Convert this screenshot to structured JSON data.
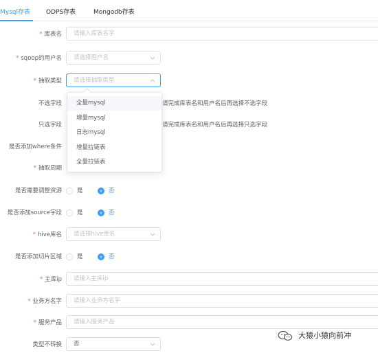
{
  "tabs": [
    {
      "label": "Mysql存表",
      "active": true
    },
    {
      "label": "ODPS存表",
      "active": false
    },
    {
      "label": "Mongodb存表",
      "active": false
    }
  ],
  "form": {
    "table_name": {
      "label": "库表名",
      "required": true,
      "placeholder": "请输入库表名字"
    },
    "sqoop_user": {
      "label": "sqoop的用户名",
      "required": true,
      "placeholder": "请选择用户名"
    },
    "extract_type": {
      "label": "抽取类型",
      "required": true,
      "placeholder": "请选择抽取类型"
    },
    "exclude_fields": {
      "label": "不选字段",
      "hint": "请完成库表名和用户名后再选择不选字段"
    },
    "only_fields": {
      "label": "只选字段",
      "hint": "请完成库表名和用户名后再选择只选字段"
    },
    "add_where": {
      "label": "是否添加where条件"
    },
    "extract_period": {
      "label": "抽取周期",
      "required": true
    },
    "adjust_resource": {
      "label": "是否需要调整资源",
      "options": [
        "是",
        "否"
      ],
      "selected": "否"
    },
    "add_source_field": {
      "label": "是否添加source字段",
      "options": [
        "是",
        "否"
      ],
      "selected": "否"
    },
    "hive_db": {
      "label": "hive库名",
      "required": true,
      "placeholder": "请选择hive库名"
    },
    "add_partition": {
      "label": "是否添加切片区域",
      "options": [
        "是",
        "否"
      ],
      "selected": "否"
    },
    "master_ip": {
      "label": "主库ip",
      "required": true,
      "placeholder": "请输入主库ip"
    },
    "business_name": {
      "label": "业务方名字",
      "required": true,
      "placeholder": "请输入业务方名字"
    },
    "service_product": {
      "label": "服务产品",
      "required": true,
      "placeholder": "请输入服务产品"
    },
    "type_no_convert": {
      "label": "类型不转换",
      "value": "否"
    }
  },
  "dropdown": {
    "options": [
      "全量mysql",
      "增量mysql",
      "日志mysql",
      "增量拉链表",
      "全量拉链表"
    ],
    "hovered": "全量mysql"
  },
  "watermark": {
    "text": "大猿小猿向前冲",
    "icon": "wechat-icon"
  },
  "colors": {
    "accent": "#409eff",
    "required": "#f56c6c",
    "border": "#dcdfe6",
    "placeholder": "#c0c4cc"
  }
}
